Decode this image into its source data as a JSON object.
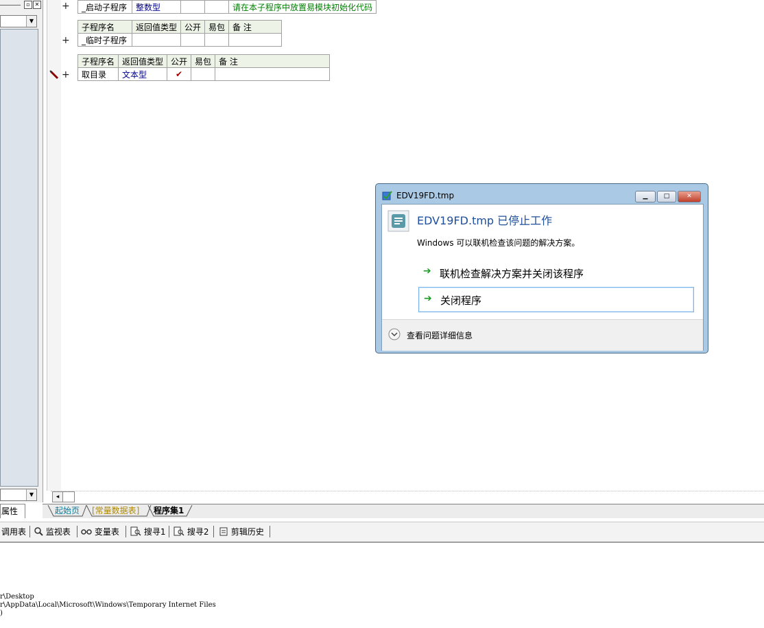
{
  "left_panel": {
    "tab_label": "属性"
  },
  "code_tables": [
    {
      "row": {
        "name": "_启动子程序",
        "return_type": "整数型",
        "public": "",
        "pkg": "",
        "note": "请在本子程序中放置易模块初始化代码"
      }
    },
    {
      "headers": [
        "子程序名",
        "返回值类型",
        "公开",
        "易包",
        "备 注"
      ],
      "row": {
        "name": "_临时子程序",
        "return_type": "",
        "public": "",
        "pkg": "",
        "note": ""
      }
    },
    {
      "headers": [
        "子程序名",
        "返回值类型",
        "公开",
        "易包",
        "备 注"
      ],
      "row": {
        "name": "取目录",
        "return_type": "文本型",
        "public": "✔",
        "pkg": "",
        "note": ""
      }
    }
  ],
  "gutter": {
    "expand_symbol": "+"
  },
  "editor_tabs": [
    {
      "label": "起始页"
    },
    {
      "label": "[常量数据表]"
    },
    {
      "label": "程序集1"
    }
  ],
  "tool_tabs": [
    {
      "label": "调用表",
      "icon": ""
    },
    {
      "label": "监视表",
      "icon": "magnifier-icon"
    },
    {
      "label": "变量表",
      "icon": "glasses-icon"
    },
    {
      "label": "搜寻1",
      "icon": "search-doc-icon"
    },
    {
      "label": "搜寻2",
      "icon": "search-doc-icon"
    },
    {
      "label": "剪辑历史",
      "icon": "clipboard-icon"
    }
  ],
  "output_lines": [
    "r\\Desktop",
    "r\\AppData\\Local\\Microsoft\\Windows\\Temporary Internet Files",
    ")"
  ],
  "dialog": {
    "window_title": "EDV19FD.tmp",
    "heading": "EDV19FD.tmp 已停止工作",
    "message": "Windows 可以联机检查该问题的解决方案。",
    "option_check_online": "联机检查解决方案并关闭该程序",
    "option_close": "关闭程序",
    "details_label": "查看问题详细信息",
    "colors": {
      "heading": "#1f4e9a",
      "arrow": "#1b9a23",
      "frame": "#a9c9e4"
    }
  },
  "colors": {
    "green_text": "#008000",
    "type_text": "#00008b",
    "header_bg": "#eef3e8"
  }
}
